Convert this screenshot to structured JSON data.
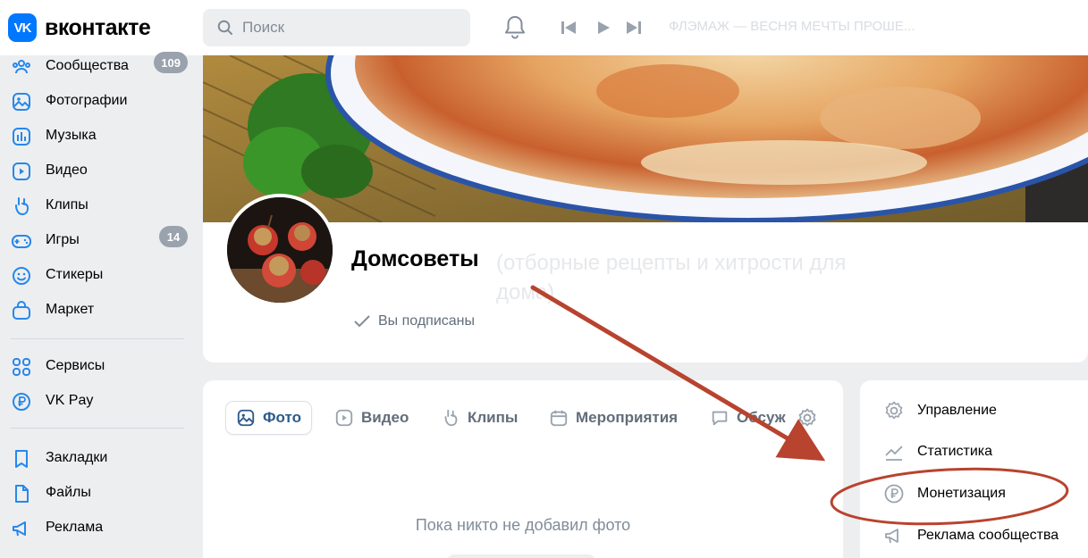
{
  "header": {
    "logo_mark": "VK",
    "logo_text": "вконтакте",
    "search_placeholder": "Поиск",
    "player_track": "ФЛЭМАЖ — ВЕСНЯ МЕЧТЫ ПРОШЕ..."
  },
  "sidebar": {
    "items": [
      {
        "label": "Сообщества",
        "badge": "109",
        "icon": "communities-icon"
      },
      {
        "label": "Фотографии",
        "icon": "photos-icon"
      },
      {
        "label": "Музыка",
        "icon": "music-icon"
      },
      {
        "label": "Видео",
        "icon": "video-icon"
      },
      {
        "label": "Клипы",
        "icon": "clips-icon"
      },
      {
        "label": "Игры",
        "badge": "14",
        "icon": "games-icon"
      },
      {
        "label": "Стикеры",
        "icon": "stickers-icon"
      },
      {
        "label": "Маркет",
        "icon": "market-icon"
      },
      {
        "label": "Сервисы",
        "icon": "services-icon"
      },
      {
        "label": "VK Pay",
        "icon": "vkpay-icon"
      },
      {
        "label": "Закладки",
        "icon": "bookmarks-icon"
      },
      {
        "label": "Файлы",
        "icon": "files-icon"
      },
      {
        "label": "Реклама",
        "icon": "ads-icon"
      }
    ]
  },
  "group": {
    "title": "Домсоветы",
    "title_faded": "(отборные рецепты и хитрости для дома)",
    "subscribed_label": "Вы подписаны"
  },
  "tabs": [
    {
      "label": "Фото",
      "icon": "photo-icon",
      "active": true
    },
    {
      "label": "Видео",
      "icon": "video-tab-icon"
    },
    {
      "label": "Клипы",
      "icon": "clips-tab-icon"
    },
    {
      "label": "Мероприятия",
      "icon": "calendar-icon"
    },
    {
      "label": "Обсуж",
      "icon": "comment-icon"
    }
  ],
  "empty_state": "Пока никто не добавил фото",
  "admin_menu": [
    {
      "label": "Управление",
      "icon": "gear-icon"
    },
    {
      "label": "Статистика",
      "icon": "chart-icon"
    },
    {
      "label": "Монетизация",
      "icon": "ruble-icon"
    },
    {
      "label": "Реклама сообщества",
      "icon": "megaphone-icon"
    }
  ],
  "colors": {
    "brand": "#0077ff",
    "annotation": "#c0392b"
  }
}
